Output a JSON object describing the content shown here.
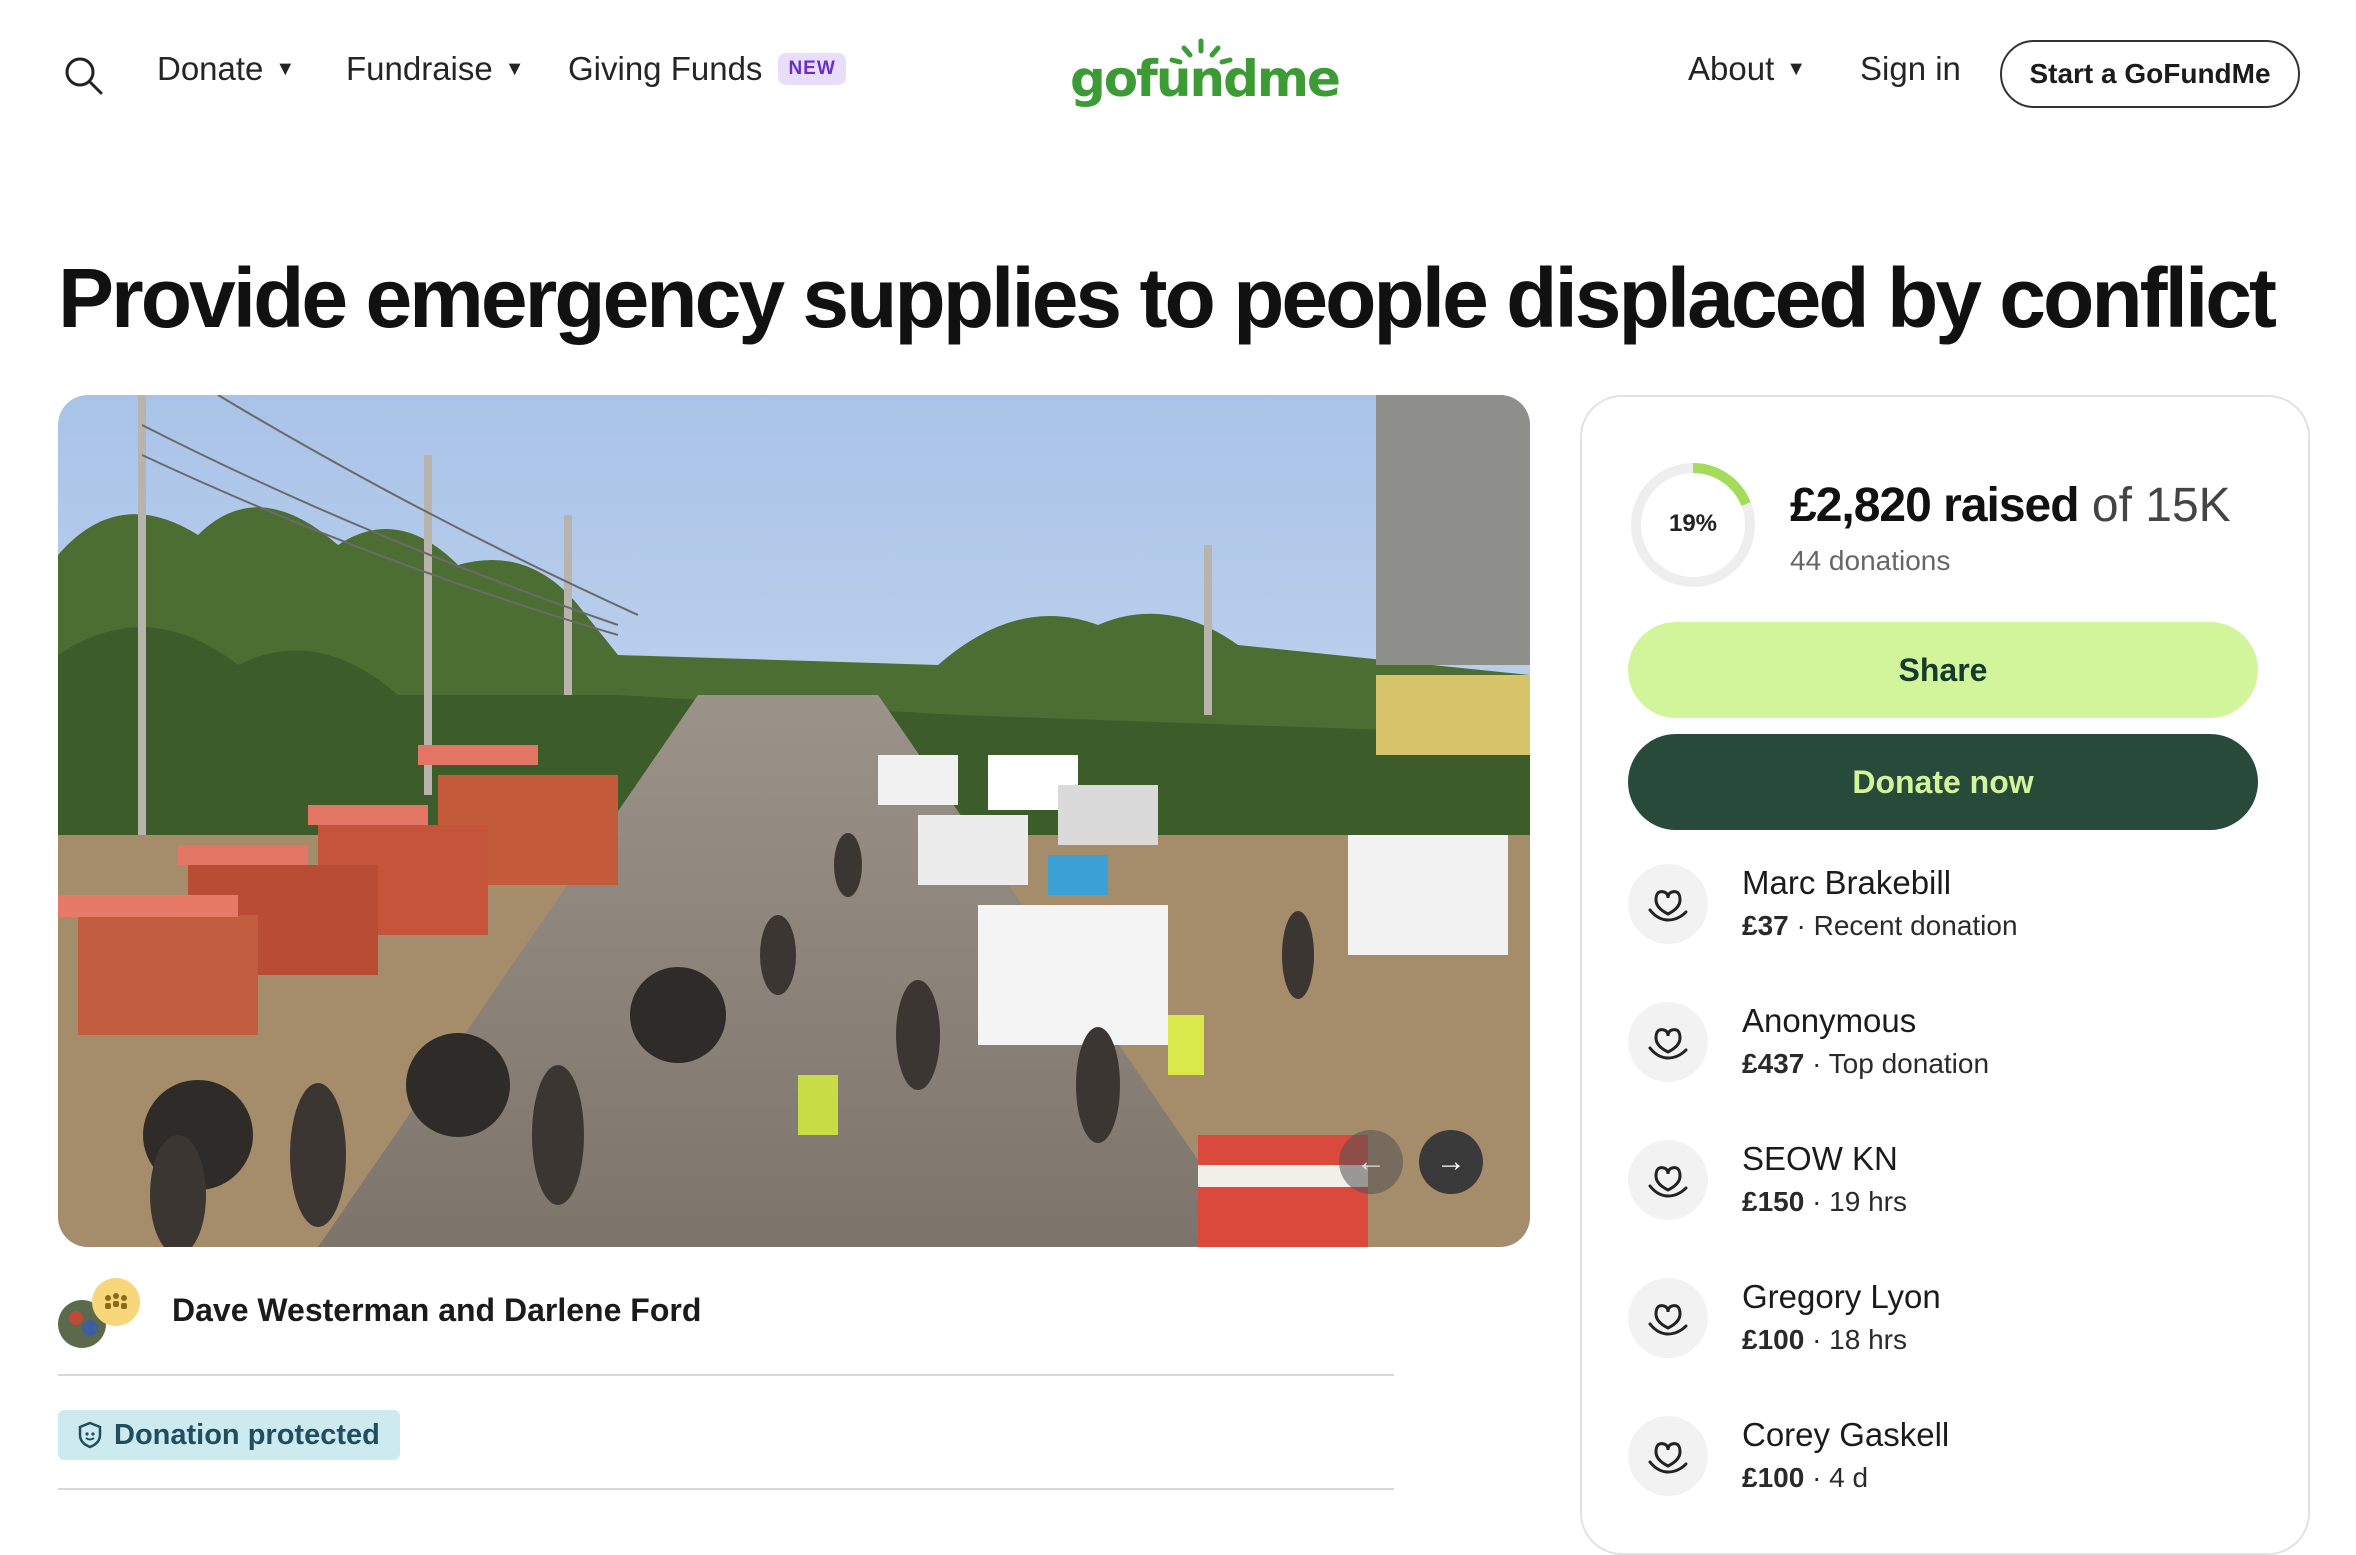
{
  "header": {
    "nav": {
      "donate": "Donate",
      "fundraise": "Fundraise",
      "giving_funds": "Giving Funds",
      "giving_funds_badge": "NEW",
      "about": "About",
      "sign_in": "Sign in"
    },
    "logo_text": "gofundme",
    "start_button": "Start a GoFundMe"
  },
  "campaign": {
    "title": "Provide emergency supplies to people displaced by conflict",
    "organizer": "Dave Westerman and Darlene Ford",
    "protected_label": "Donation protected"
  },
  "progress": {
    "percent_label": "19%",
    "percent_value": 19,
    "raised": "£2,820 raised",
    "goal": "of 15K",
    "donations": "44 donations",
    "share_label": "Share",
    "donate_label": "Donate now"
  },
  "donors": [
    {
      "name": "Marc Brakebill",
      "amount": "£37",
      "detail": " · Recent donation"
    },
    {
      "name": "Anonymous",
      "amount": "£437",
      "detail": " · Top donation"
    },
    {
      "name": "SEOW KN",
      "amount": "£150",
      "detail": " · 19 hrs"
    },
    {
      "name": "Gregory Lyon",
      "amount": "£100",
      "detail": " · 18 hrs"
    },
    {
      "name": "Corey Gaskell",
      "amount": "£100",
      "detail": " · 4 d"
    }
  ],
  "colors": {
    "brand_green": "#3c9b35",
    "share_button": "#d2f59c",
    "donate_button": "#284a3a",
    "protected_badge": "#cdebef",
    "progress_ring": "#a3dc58"
  },
  "icons": {
    "search": "search-icon",
    "caret": "chevron-down-icon",
    "carousel_prev": "arrow-left-icon",
    "carousel_next": "arrow-right-icon",
    "shield": "shield-icon",
    "donor": "heart-hand-icon"
  }
}
